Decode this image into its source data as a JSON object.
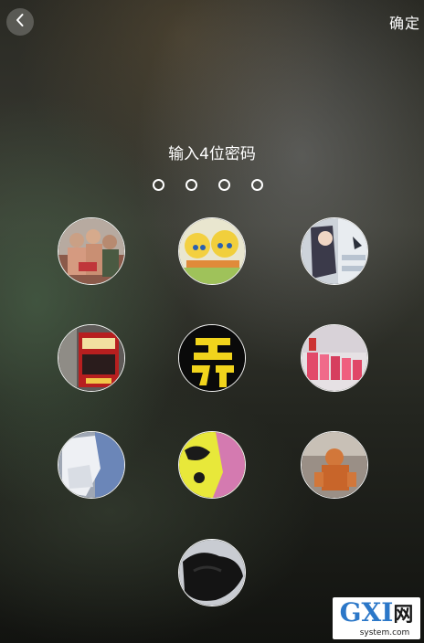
{
  "header": {
    "back_icon": "chevron-left-icon",
    "confirm_label": "确定"
  },
  "prompt": {
    "title": "输入4位密码",
    "digits_total": 4,
    "digits_entered": 0
  },
  "keypad": {
    "keys": [
      {
        "image": "group-of-men-photo"
      },
      {
        "image": "anime-characters-photo"
      },
      {
        "image": "anime-figure-photo"
      },
      {
        "image": "red-sign-storefront-photo"
      },
      {
        "image": "yellow-calligraphy-text-photo"
      },
      {
        "image": "stage-performers-photo"
      },
      {
        "image": "white-cloth-photo"
      },
      {
        "image": "yellow-pink-cartoon-photo"
      },
      {
        "image": "orange-figurine-photo"
      },
      {
        "image": "black-clothing-photo"
      }
    ]
  },
  "watermark": {
    "logo_text": "GXI",
    "logo_cn": "网",
    "site": "system.com"
  },
  "colors": {
    "text": "#ffffff",
    "watermark_blue": "#2b77c8"
  }
}
